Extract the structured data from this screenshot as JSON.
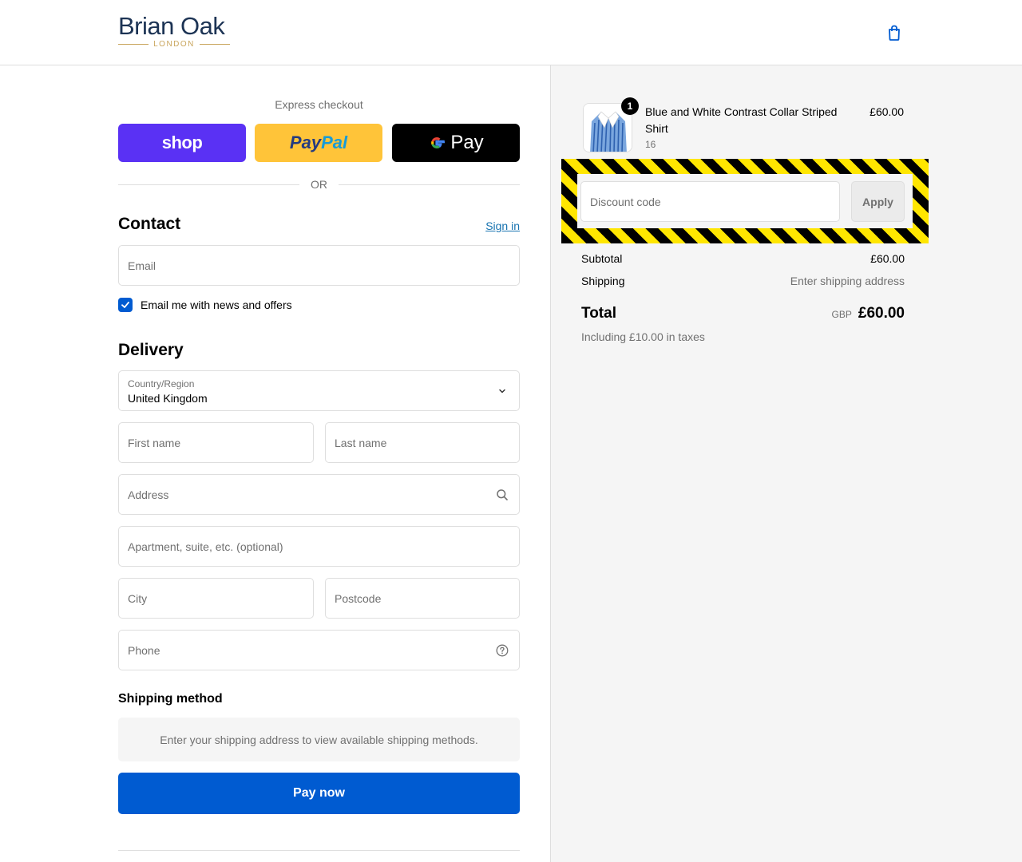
{
  "brand": {
    "name": "Brian Oak",
    "subtitle": "LONDON"
  },
  "header": {
    "cart_icon": "shopping-bag-icon"
  },
  "express": {
    "title": "Express checkout",
    "shop_label": "shop",
    "paypal_label_1": "Pay",
    "paypal_label_2": "Pal",
    "gpay_label": "Pay",
    "or_label": "OR"
  },
  "contact": {
    "heading": "Contact",
    "signin_label": "Sign in",
    "email_placeholder": "Email",
    "newsletter_label": "Email me with news and offers",
    "newsletter_checked": true
  },
  "delivery": {
    "heading": "Delivery",
    "country_label": "Country/Region",
    "country_value": "United Kingdom",
    "first_name_placeholder": "First name",
    "last_name_placeholder": "Last name",
    "address_placeholder": "Address",
    "apartment_placeholder": "Apartment, suite, etc. (optional)",
    "city_placeholder": "City",
    "postcode_placeholder": "Postcode",
    "phone_placeholder": "Phone"
  },
  "shipping": {
    "heading": "Shipping method",
    "message": "Enter your shipping address to view available shipping methods."
  },
  "pay_now_label": "Pay now",
  "order": {
    "item": {
      "name": "Blue and White Contrast Collar Striped Shirt",
      "variant": "16",
      "price": "£60.00",
      "quantity": "1"
    },
    "discount_placeholder": "Discount code",
    "apply_label": "Apply",
    "subtotal_label": "Subtotal",
    "subtotal_value": "£60.00",
    "shipping_label": "Shipping",
    "shipping_value": "Enter shipping address",
    "total_label": "Total",
    "total_currency": "GBP",
    "total_value": "£60.00",
    "taxes_note": "Including £10.00 in taxes"
  },
  "colors": {
    "primary": "#005bd1",
    "shop": "#5a31f4",
    "paypal": "#ffc439",
    "hazard_yellow": "#ffe600"
  }
}
